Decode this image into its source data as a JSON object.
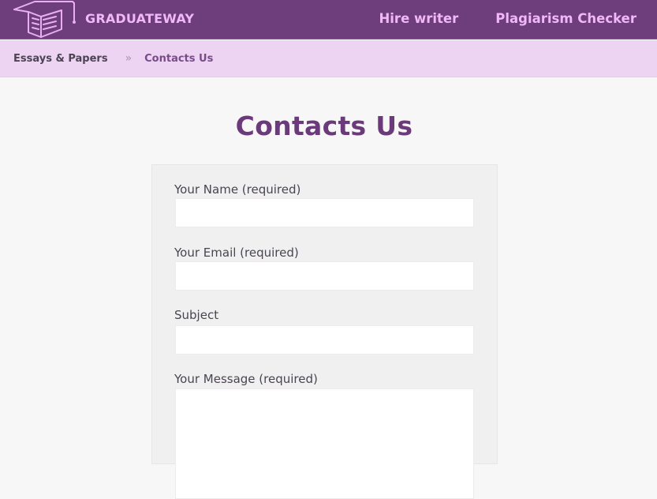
{
  "header": {
    "brand": "GRADUATEWAY",
    "logo_icon": "graduation-cap-book-icon",
    "nav": [
      {
        "label": "Hire writer"
      },
      {
        "label": "Plagiarism Checker"
      }
    ],
    "colors": {
      "bar": "#6e3d7c",
      "link": "#f0b8f4"
    }
  },
  "breadcrumb": {
    "items": [
      {
        "label": "Essays & Papers"
      },
      {
        "label": "Contacts Us"
      }
    ],
    "separator": "»",
    "background": "#ecd4f2"
  },
  "page": {
    "title": "Contacts Us",
    "title_color": "#6b3a7a"
  },
  "form": {
    "fields": [
      {
        "label": "Your Name (required)",
        "value": "",
        "placeholder": ""
      },
      {
        "label": "Your Email (required)",
        "value": "",
        "placeholder": ""
      },
      {
        "label": "Subject",
        "value": "",
        "placeholder": ""
      },
      {
        "label": "Your Message (required)",
        "value": "",
        "placeholder": ""
      }
    ]
  }
}
